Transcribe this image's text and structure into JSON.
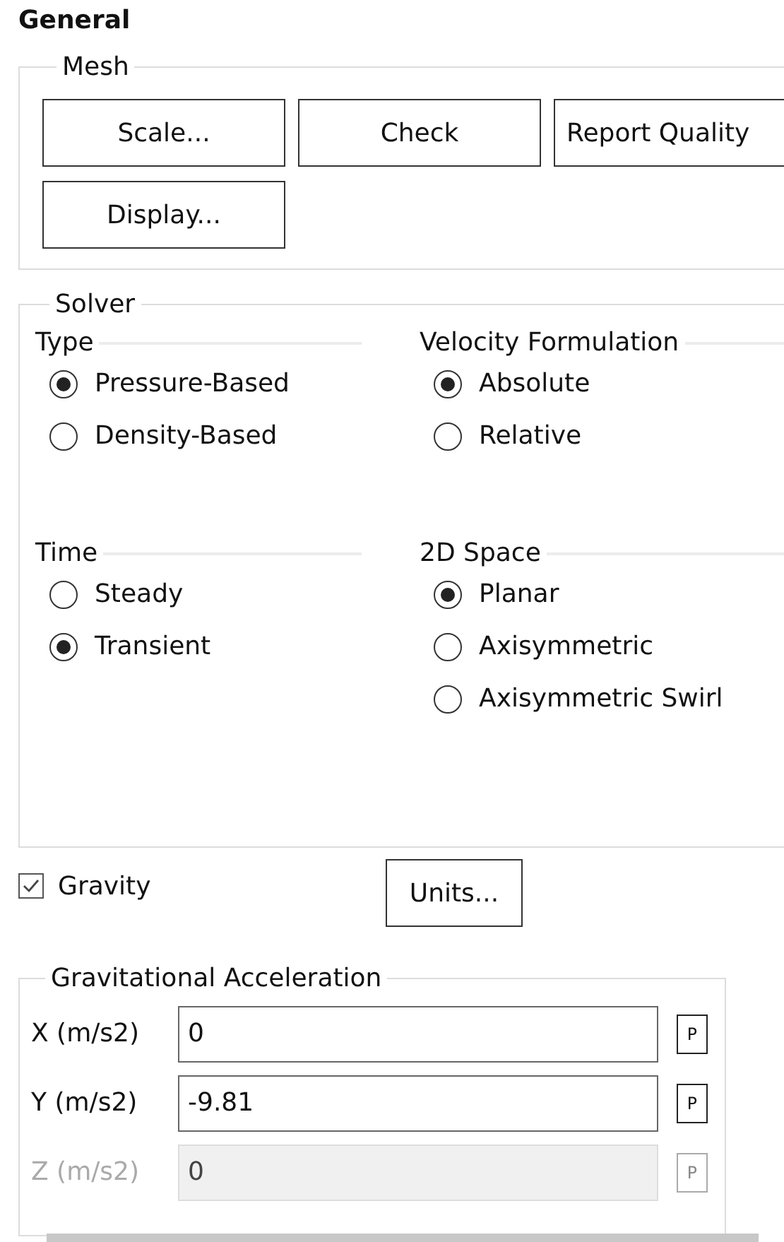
{
  "title": "General",
  "mesh": {
    "legend": "Mesh",
    "buttons": [
      "Scale...",
      "Check",
      "Report Quality",
      "Display..."
    ]
  },
  "solver": {
    "legend": "Solver",
    "groups": [
      {
        "heading": "Type",
        "options": [
          {
            "label": "Pressure-Based",
            "selected": true
          },
          {
            "label": "Density-Based",
            "selected": false
          }
        ]
      },
      {
        "heading": "Velocity Formulation",
        "options": [
          {
            "label": "Absolute",
            "selected": true
          },
          {
            "label": "Relative",
            "selected": false
          }
        ]
      },
      {
        "heading": "Time",
        "options": [
          {
            "label": "Steady",
            "selected": false
          },
          {
            "label": "Transient",
            "selected": true
          }
        ]
      },
      {
        "heading": "2D Space",
        "options": [
          {
            "label": "Planar",
            "selected": true
          },
          {
            "label": "Axisymmetric",
            "selected": false
          },
          {
            "label": "Axisymmetric Swirl",
            "selected": false
          }
        ]
      }
    ]
  },
  "gravity": {
    "label": "Gravity",
    "checked": true
  },
  "units_button": "Units...",
  "acceleration": {
    "legend": "Gravitational Acceleration",
    "rows": [
      {
        "label": "X (m/s2)",
        "value": "0",
        "param": "P",
        "disabled": false
      },
      {
        "label": "Y (m/s2)",
        "value": "-9.81",
        "param": "P",
        "disabled": false
      },
      {
        "label": "Z (m/s2)",
        "value": "0",
        "param": "P",
        "disabled": true
      }
    ]
  }
}
